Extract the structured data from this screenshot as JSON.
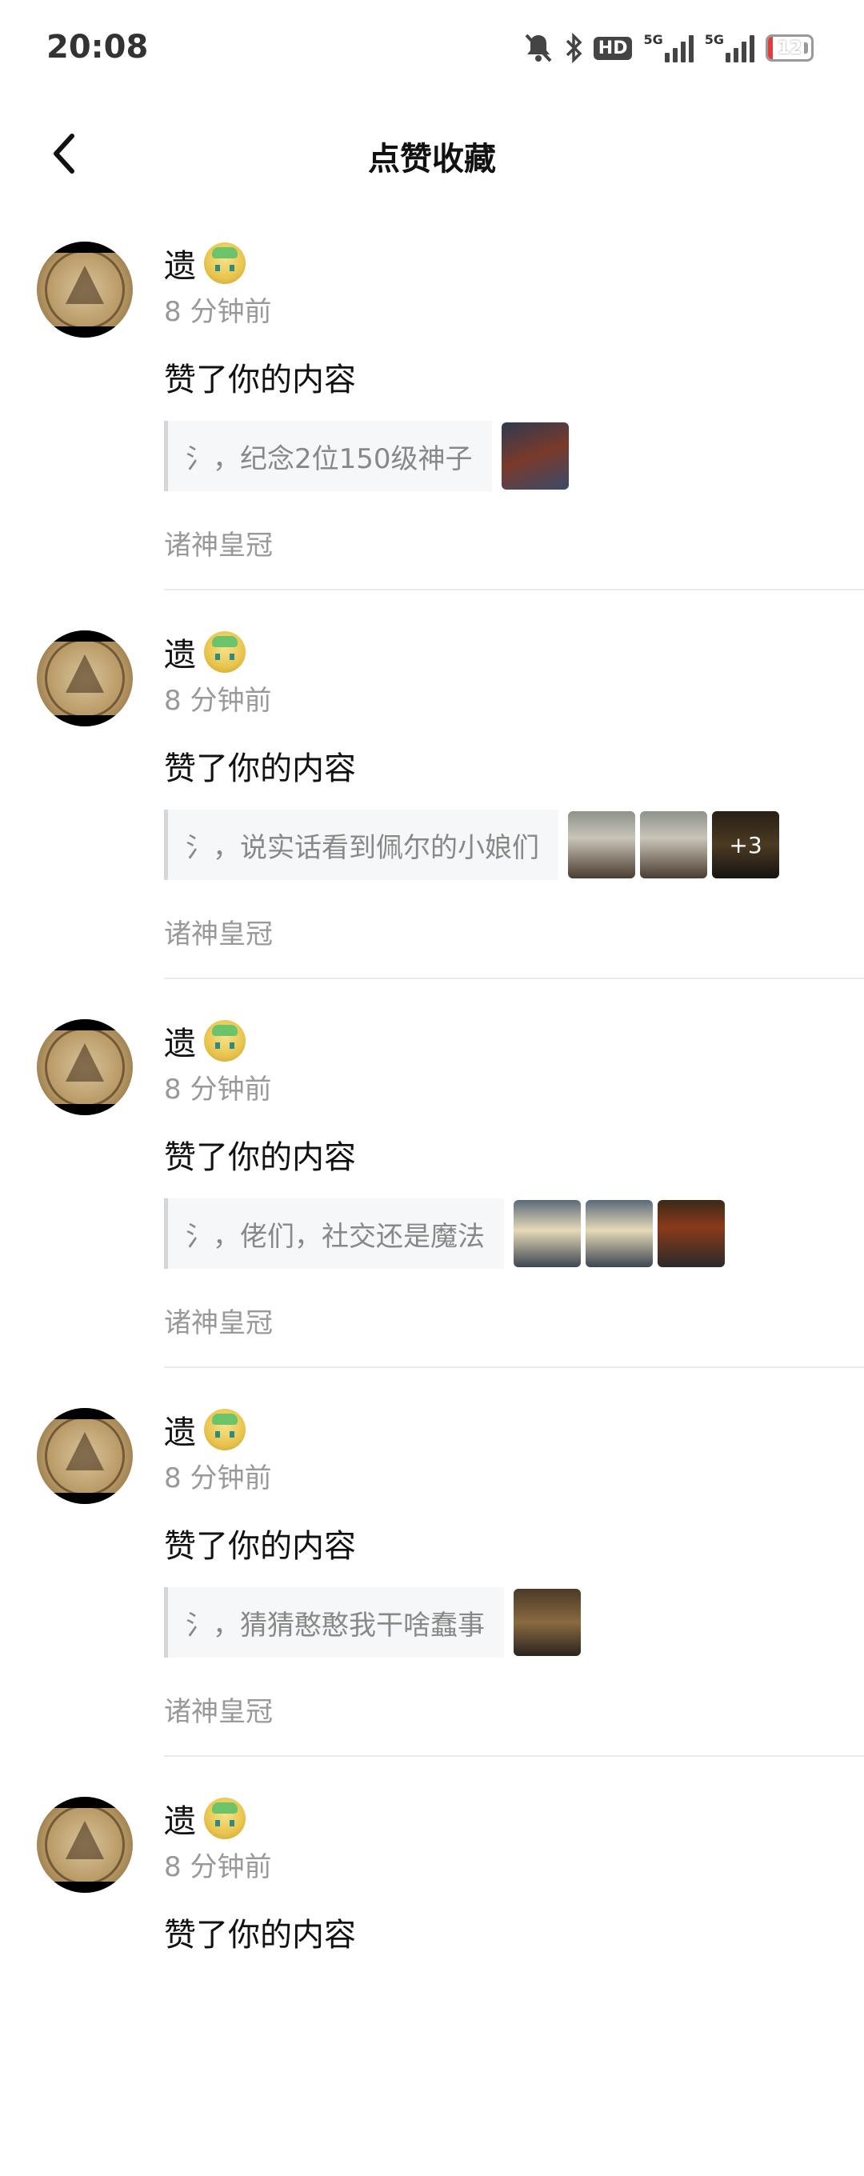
{
  "status_bar": {
    "time": "20:08",
    "icons": [
      "mute-bell-icon",
      "bluetooth-icon",
      "hd-icon",
      "signal-5g-icon",
      "signal-5g-icon",
      "battery-icon"
    ],
    "hd_label": "HD",
    "net1_label": "5G",
    "net2_label": "5G",
    "battery_level": "12"
  },
  "header": {
    "title": "点赞收藏"
  },
  "items": [
    {
      "name": "遗",
      "time": "8 分钟前",
      "action": "赞了你的内容",
      "quote": "氵，纪念2位150级神子",
      "thumb_more": "",
      "source": "诸神皇冠"
    },
    {
      "name": "遗",
      "time": "8 分钟前",
      "action": "赞了你的内容",
      "quote": "氵，说实话看到佩尔的小娘们",
      "thumb_more": "+3",
      "source": "诸神皇冠"
    },
    {
      "name": "遗",
      "time": "8 分钟前",
      "action": "赞了你的内容",
      "quote": "氵，佬们，社交还是魔法",
      "thumb_more": "",
      "source": "诸神皇冠"
    },
    {
      "name": "遗",
      "time": "8 分钟前",
      "action": "赞了你的内容",
      "quote": "氵，猜猜憨憨我干啥蠢事",
      "thumb_more": "",
      "source": "诸神皇冠"
    },
    {
      "name": "遗",
      "time": "8 分钟前",
      "action": "赞了你的内容",
      "quote": "",
      "thumb_more": "",
      "source": ""
    }
  ]
}
